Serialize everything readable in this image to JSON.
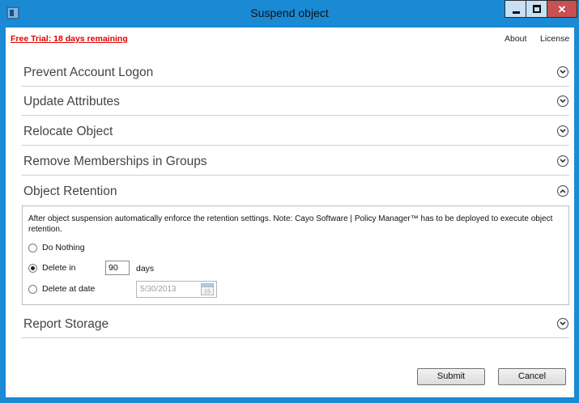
{
  "window": {
    "title": "Suspend object"
  },
  "header": {
    "trial_text": "Free Trial: 18 days remaining",
    "about_label": "About",
    "license_label": "License"
  },
  "sections": [
    {
      "label": "Prevent Account Logon",
      "expanded": false
    },
    {
      "label": "Update Attributes",
      "expanded": false
    },
    {
      "label": "Relocate Object",
      "expanded": false
    },
    {
      "label": "Remove Memberships in Groups",
      "expanded": false
    },
    {
      "label": "Object Retention",
      "expanded": true
    },
    {
      "label": "Report Storage",
      "expanded": false
    }
  ],
  "retention": {
    "description": "After object suspension automatically enforce the retention settings. Note: Cayo Software | Policy Manager™ has to be deployed to execute object retention.",
    "options": {
      "do_nothing": "Do Nothing",
      "delete_in": "Delete in",
      "delete_at_date": "Delete at date"
    },
    "selected": "delete_in",
    "days_value": "90",
    "days_unit": "days",
    "date_value": "5/30/2013",
    "calendar_day": "15"
  },
  "footer": {
    "submit_label": "Submit",
    "cancel_label": "Cancel"
  },
  "colors": {
    "window_frame": "#1a8ad4",
    "trial_red": "#e00000",
    "close_button": "#c75050"
  },
  "icons": {
    "app": "app-icon",
    "expand": "chevron-down-circle-icon",
    "collapse": "chevron-up-circle-icon",
    "calendar": "calendar-icon"
  }
}
